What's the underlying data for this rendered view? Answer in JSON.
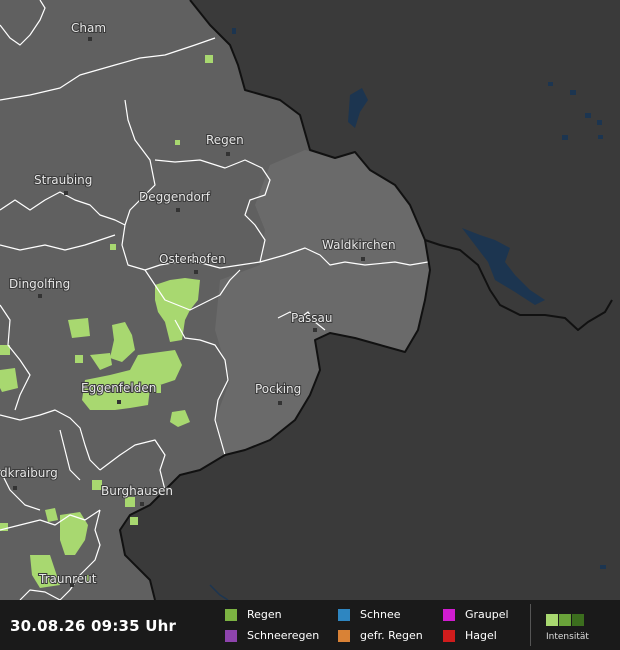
{
  "map": {
    "cities": [
      {
        "id": "cham",
        "name": "Cham"
      },
      {
        "id": "regen",
        "name": "Regen"
      },
      {
        "id": "straubing",
        "name": "Straubing"
      },
      {
        "id": "deggendorf",
        "name": "Deggendorf"
      },
      {
        "id": "waldkirchen",
        "name": "Waldkirchen"
      },
      {
        "id": "osterhofen",
        "name": "Osterhofen"
      },
      {
        "id": "dingolfing",
        "name": "Dingolfing"
      },
      {
        "id": "passau",
        "name": "Passau"
      },
      {
        "id": "eggenfelden",
        "name": "Eggenfelden"
      },
      {
        "id": "pocking",
        "name": "Pocking"
      },
      {
        "id": "waldkraiburg",
        "name": "dkraiburg"
      },
      {
        "id": "burghausen",
        "name": "Burghausen"
      },
      {
        "id": "traunreut",
        "name": "Traunreut"
      }
    ],
    "colors": {
      "land_inside": "#606060",
      "land_outside": "#3a3a3a",
      "region_lines": "#ffffff",
      "border": "#111111",
      "water": "#1c3550",
      "rain": "#a8d870"
    }
  },
  "legend": {
    "timestamp": "30.08.26 09:35 Uhr",
    "items": [
      {
        "label": "Regen",
        "color": "#7cb342"
      },
      {
        "label": "Schneeregen",
        "color": "#8e44ad"
      },
      {
        "label": "Schnee",
        "color": "#2e86c1"
      },
      {
        "label": "gefr. Regen",
        "color": "#d98236"
      },
      {
        "label": "Graupel",
        "color": "#d01cd0"
      },
      {
        "label": "Hagel",
        "color": "#d01c1c"
      }
    ],
    "intensity_label": "Intensität",
    "intensity_colors": [
      "#a8d870",
      "#6aa33a",
      "#3c6e1e"
    ]
  }
}
